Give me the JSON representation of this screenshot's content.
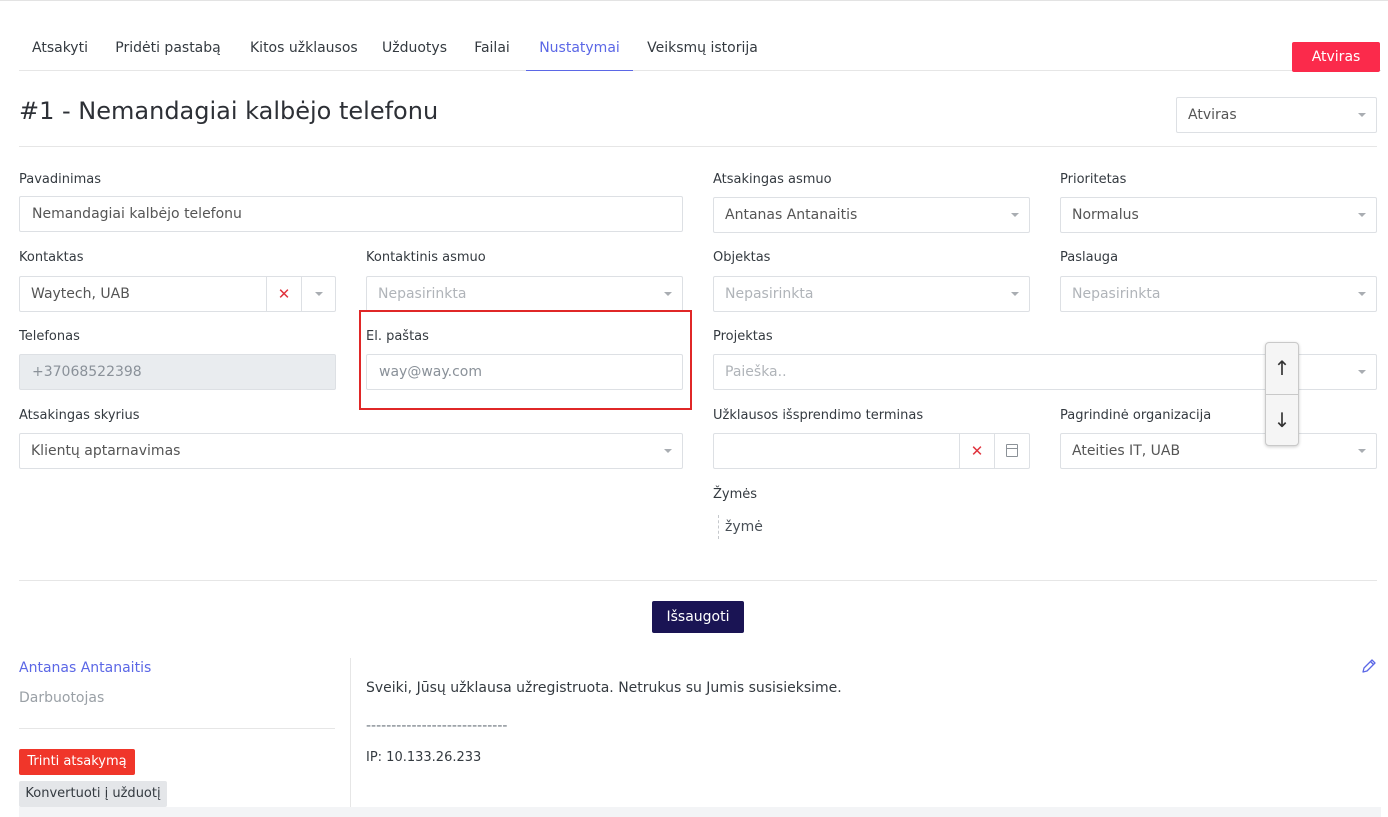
{
  "tabs": [
    {
      "label": "Atsakyti"
    },
    {
      "label": "Pridėti pastabą"
    },
    {
      "label": "Kitos užklausos"
    },
    {
      "label": "Užduotys"
    },
    {
      "label": "Failai"
    },
    {
      "label": "Nustatymai",
      "active": true
    },
    {
      "label": "Veiksmų istorija"
    }
  ],
  "status_button": "Atviras",
  "ticket_title": "#1 - Nemandagiai kalbėjo telefonu",
  "status_select": {
    "value": "Atviras"
  },
  "form": {
    "pavadinimas": {
      "label": "Pavadinimas",
      "value": "Nemandagiai kalbėjo telefonu"
    },
    "atsakingas_asmuo": {
      "label": "Atsakingas asmuo",
      "value": "Antanas Antanaitis"
    },
    "prioritetas": {
      "label": "Prioritetas",
      "value": "Normalus"
    },
    "kontaktas": {
      "label": "Kontaktas",
      "value": "Waytech, UAB"
    },
    "kontaktinis_asmuo": {
      "label": "Kontaktinis asmuo",
      "placeholder": "Nepasirinkta"
    },
    "objektas": {
      "label": "Objektas",
      "placeholder": "Nepasirinkta"
    },
    "paslauga": {
      "label": "Paslauga",
      "placeholder": "Nepasirinkta"
    },
    "telefonas": {
      "label": "Telefonas",
      "value": "+37068522398"
    },
    "el_pastas": {
      "label": "El. paštas",
      "placeholder": "way@way.com"
    },
    "projektas": {
      "label": "Projektas",
      "placeholder": "Paieška.."
    },
    "atsakingas_skyrius": {
      "label": "Atsakingas skyrius",
      "value": "Klientų aptarnavimas"
    },
    "terminas": {
      "label": "Užklausos išsprendimo terminas",
      "value": ""
    },
    "pagrindine_organizacija": {
      "label": "Pagrindinė organizacija",
      "value": "Ateities IT, UAB"
    },
    "zymes": {
      "label": "Žymės",
      "tag": "žymė"
    }
  },
  "icons": {
    "clear": "✕",
    "arrow_up": "↑",
    "arrow_down": "↓"
  },
  "save_button": "Išsaugoti",
  "reply": {
    "author": "Antanas Antanaitis",
    "role": "Darbuotojas",
    "delete_button": "Trinti atsakymą",
    "convert_button": "Konvertuoti į užduotį",
    "message": "Sveiki, Jūsų užklausa užregistruota. Netrukus su Jumis susisieksime.",
    "separator": "----------------------------",
    "ip": "IP: 10.133.26.233"
  },
  "colors": {
    "accent": "#5b67e6",
    "status_red": "#fb2a4b",
    "save_navy": "#1a1454",
    "delete_red": "#f0362a",
    "highlight_red": "#e02727"
  }
}
